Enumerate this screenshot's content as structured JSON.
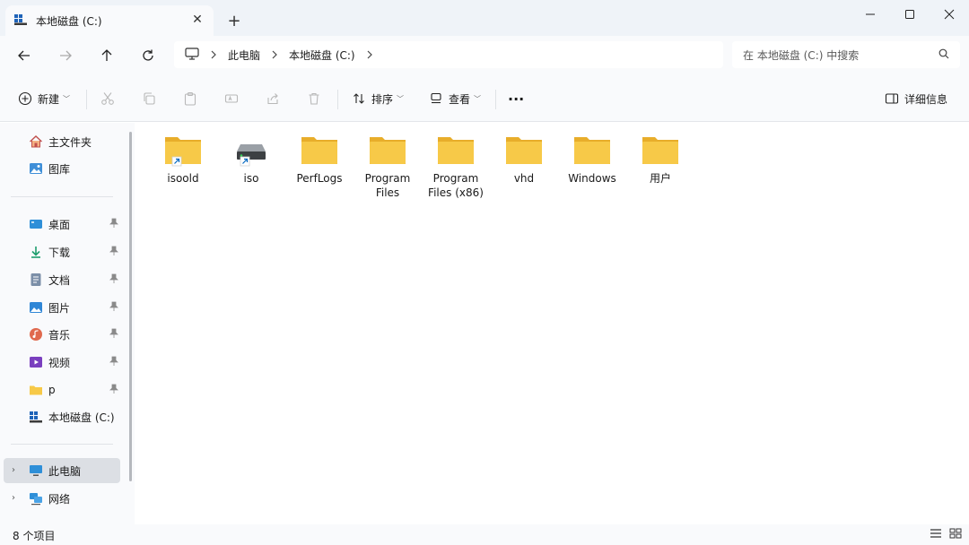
{
  "tab": {
    "title": "本地磁盘 (C:)",
    "close": "✕",
    "new_tab": "+"
  },
  "window": {
    "minimize": "—",
    "maximize": "☐",
    "close": "✕"
  },
  "address": {
    "crumbs": [
      "此电脑",
      "本地磁盘 (C:)"
    ]
  },
  "search": {
    "placeholder": "在 本地磁盘 (C:) 中搜索"
  },
  "toolbar": {
    "new_label": "新建",
    "sort_label": "排序",
    "view_label": "查看",
    "more_label": "···",
    "details_label": "详细信息"
  },
  "sidebar": {
    "quick": [
      {
        "label": "主文件夹",
        "icon": "home-icon"
      },
      {
        "label": "图库",
        "icon": "gallery-icon"
      }
    ],
    "pinned": [
      {
        "label": "桌面",
        "icon": "desktop-icon"
      },
      {
        "label": "下载",
        "icon": "download-icon"
      },
      {
        "label": "文档",
        "icon": "document-icon"
      },
      {
        "label": "图片",
        "icon": "pictures-icon"
      },
      {
        "label": "音乐",
        "icon": "music-icon"
      },
      {
        "label": "视频",
        "icon": "video-icon"
      },
      {
        "label": "p",
        "icon": "folder-icon"
      },
      {
        "label": "本地磁盘 (C:)",
        "icon": "drive-icon"
      }
    ],
    "this_pc": "此电脑",
    "network": "网络"
  },
  "files": [
    {
      "name": "isoold",
      "type": "folder-shortcut"
    },
    {
      "name": "iso",
      "type": "drive-shortcut"
    },
    {
      "name": "PerfLogs",
      "type": "folder"
    },
    {
      "name": "Program Files",
      "type": "folder"
    },
    {
      "name": "Program Files (x86)",
      "type": "folder"
    },
    {
      "name": "vhd",
      "type": "folder"
    },
    {
      "name": "Windows",
      "type": "folder"
    },
    {
      "name": "用户",
      "type": "folder"
    }
  ],
  "status": {
    "item_count": "8 个项目"
  },
  "colors": {
    "folder": "#f7c948",
    "folder_back": "#e8ad2a",
    "accent": "#0067c0"
  }
}
